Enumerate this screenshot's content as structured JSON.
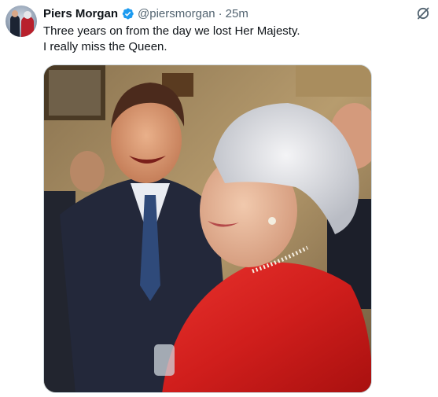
{
  "tweet": {
    "author": {
      "display_name": "Piers Morgan",
      "handle": "@piersmorgan",
      "verified": true,
      "verified_color": "#1d9bf0"
    },
    "separator": "·",
    "time": "25m",
    "text_lines": [
      "Three years on from the day we lost Her Majesty.",
      "I really miss the Queen."
    ],
    "header_icon": "grok-icon",
    "media": {
      "type": "photo"
    }
  },
  "colors": {
    "text": "#0f1419",
    "secondary_text": "#536471",
    "verified": "#1d9bf0",
    "border": "#cfd9de"
  }
}
